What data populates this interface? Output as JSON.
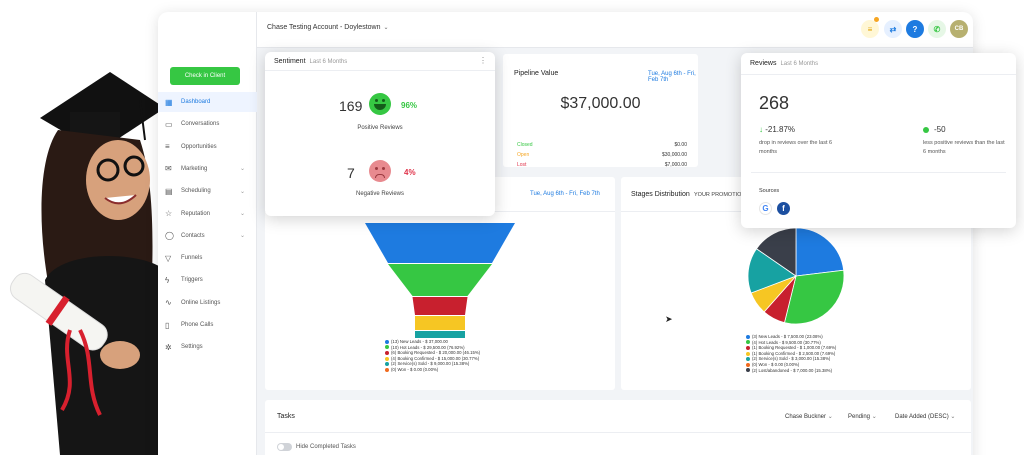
{
  "topbar": {
    "account": "Chase Testing Account - Doylestown",
    "avatar_initials": "CB",
    "help_label": "?"
  },
  "sidebar": {
    "checkin_label": "Check in Client",
    "items": [
      {
        "label": "Dashboard",
        "icon": "dashboard-icon",
        "active": true,
        "caret": false
      },
      {
        "label": "Conversations",
        "icon": "chat-icon",
        "active": false,
        "caret": false
      },
      {
        "label": "Opportunities",
        "icon": "funnel-stack-icon",
        "active": false,
        "caret": false
      },
      {
        "label": "Marketing",
        "icon": "mail-icon",
        "active": false,
        "caret": true
      },
      {
        "label": "Scheduling",
        "icon": "calendar-icon",
        "active": false,
        "caret": true
      },
      {
        "label": "Reputation",
        "icon": "star-icon",
        "active": false,
        "caret": true
      },
      {
        "label": "Contacts",
        "icon": "person-icon",
        "active": false,
        "caret": true
      },
      {
        "label": "Funnels",
        "icon": "filter-icon",
        "active": false,
        "caret": false
      },
      {
        "label": "Triggers",
        "icon": "bolt-icon",
        "active": false,
        "caret": false
      },
      {
        "label": "Online Listings",
        "icon": "pulse-icon",
        "active": false,
        "caret": false
      },
      {
        "label": "Phone Calls",
        "icon": "phone-icon",
        "active": false,
        "caret": false
      },
      {
        "label": "Settings",
        "icon": "gear-icon",
        "active": false,
        "caret": false
      }
    ]
  },
  "sentiment": {
    "title": "Sentiment",
    "period": "Last 6 Months",
    "positive_count": "169",
    "positive_pct": "96%",
    "positive_label": "Positive Reviews",
    "negative_count": "7",
    "negative_pct": "4%",
    "negative_label": "Negative Reviews"
  },
  "pipeline": {
    "title": "Pipeline Value",
    "date": "Tue, Aug 6th - Fri, Feb 7th",
    "value": "$37,000.00",
    "rows": [
      {
        "label": "Closed",
        "value": "$0.00",
        "color": "#36c743"
      },
      {
        "label": "Open",
        "value": "$30,000.00",
        "color": "#f6a623"
      },
      {
        "label": "Lost",
        "value": "$7,000.00",
        "color": "#e0334a"
      }
    ]
  },
  "reviews": {
    "title": "Reviews",
    "period": "Last 6 Months",
    "total": "268",
    "change_pct": "-21.87%",
    "change_text": "drop in reviews over the last 6 months",
    "change_abs": "-50",
    "change_abs_text": "less positive reviews than the last 6 months",
    "sources_label": "Sources"
  },
  "funnel": {
    "date": "Tue, Aug 6th - Fri, Feb 7th",
    "legend": [
      {
        "text": "(13) New Leads - $ 37,000.00",
        "color": "#1e7be0"
      },
      {
        "text": "(10) Hot Leads - $ 29,500.00 (76.92%)",
        "color": "#36c743"
      },
      {
        "text": "(6) Booking Requested - $ 20,000.00 (46.15%)",
        "color": "#c8202e"
      },
      {
        "text": "(4) Booking Confirmed - $ 15,000.00 (30.77%)",
        "color": "#f6c623"
      },
      {
        "text": "(2) Service(s) Sold - $ 9,000.00 (15.38%)",
        "color": "#17a2a2"
      },
      {
        "text": "(0) Won - $ 0.00 (0.00%)",
        "color": "#f06a1e"
      }
    ]
  },
  "stages": {
    "title": "Stages Distribution",
    "filter": "YOUR PROMOTION",
    "legend": [
      {
        "text": "(3) New Leads - $ 7,500.00 (23.08%)",
        "color": "#1e7be0"
      },
      {
        "text": "(4) Hot Leads - $ 9,500.00 (30.77%)",
        "color": "#36c743"
      },
      {
        "text": "(1) Booking Requested - $ 1,000.00 (7.69%)",
        "color": "#c8202e"
      },
      {
        "text": "(1) Booking Confirmed - $ 2,500.00 (7.69%)",
        "color": "#f6c623"
      },
      {
        "text": "(2) Service(s) Sold - $ 3,000.00 (15.38%)",
        "color": "#17a2a2"
      },
      {
        "text": "(0) Won - $ 0.00 (0.00%)",
        "color": "#f06a1e"
      },
      {
        "text": "(2) Lost/abandoned - $ 7,000.00 (15.38%)",
        "color": "#3a3f4a"
      }
    ]
  },
  "tasks": {
    "title": "Tasks",
    "assignee": "Chase Buckner",
    "status": "Pending",
    "sort": "Date Added (DESC)",
    "toggle_label": "Hide Completed Tasks"
  },
  "chart_data": [
    {
      "type": "bar",
      "categories": [
        "New Leads",
        "Hot Leads",
        "Booking Requested",
        "Booking Confirmed",
        "Service(s) Sold",
        "Won"
      ],
      "values": [
        37000,
        29500,
        20000,
        15000,
        9000,
        0
      ],
      "counts": [
        13,
        10,
        6,
        4,
        2,
        0
      ],
      "colors": [
        "#1e7be0",
        "#36c743",
        "#c8202e",
        "#f6c623",
        "#17a2a2",
        "#f06a1e"
      ],
      "title": ""
    },
    {
      "type": "pie",
      "categories": [
        "New Leads",
        "Hot Leads",
        "Booking Requested",
        "Booking Confirmed",
        "Service(s) Sold",
        "Won",
        "Lost/abandoned"
      ],
      "values": [
        23.08,
        30.77,
        7.69,
        7.69,
        15.38,
        0,
        15.38
      ],
      "colors": [
        "#1e7be0",
        "#36c743",
        "#c8202e",
        "#f6c623",
        "#17a2a2",
        "#f06a1e",
        "#3a3f4a"
      ],
      "title": "Stages Distribution"
    }
  ]
}
